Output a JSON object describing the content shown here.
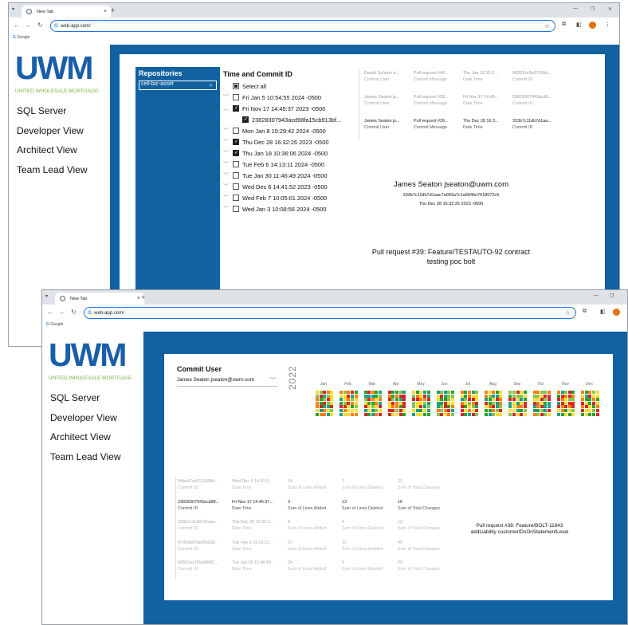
{
  "browser": {
    "tab_title": "New Tab",
    "address": "web-app.com/",
    "bookmark": "Google"
  },
  "sidebar": {
    "logo": "UWM",
    "tagline": "UNITED WHOLESALE MORTGAGE",
    "items": [
      {
        "label": "SQL Server"
      },
      {
        "label": "Developer View"
      },
      {
        "label": "Architect View"
      },
      {
        "label": "Team Lead View"
      }
    ]
  },
  "architect": {
    "repo_label": "Repositories",
    "repo_value": "cell-biz-asset",
    "slicer_title": "Time and Commit ID",
    "select_all": "Select all",
    "rows": [
      {
        "label": "Fri Jan 5 10:54:55 2024 -0500",
        "chev": "﹀",
        "state": "off",
        "indent": 0
      },
      {
        "label": "Fri Nov 17 14:45:37 2023 -0500",
        "chev": "︿",
        "state": "on",
        "indent": 0
      },
      {
        "label": "23828307943acd98fa15cb913bf...",
        "chev": "",
        "state": "on",
        "indent": 1
      },
      {
        "label": "Mon Jan 8 10:29:42 2024 -0500",
        "chev": "﹀",
        "state": "off",
        "indent": 0
      },
      {
        "label": "Thu Dec 28 16:32:26 2023 -0500",
        "chev": "﹀",
        "state": "on",
        "indent": 0
      },
      {
        "label": "Thu Jan 18 10:36:06 2024 -0500",
        "chev": "﹀",
        "state": "on",
        "indent": 0
      },
      {
        "label": "Tue Feb 6 14:13:11 2024 -0500",
        "chev": "﹀",
        "state": "off",
        "indent": 0
      },
      {
        "label": "Tue Jan 30 11:46:49 2024 -0500",
        "chev": "﹀",
        "state": "off",
        "indent": 0
      },
      {
        "label": "Wed Dec 6 14:41:52 2023 -0500",
        "chev": "﹀",
        "state": "off",
        "indent": 0
      },
      {
        "label": "Wed Feb 7 10:05:01 2024 -0500",
        "chev": "﹀",
        "state": "off",
        "indent": 0
      },
      {
        "label": "Wed Jan 3 10:08:56 2024 -0500",
        "chev": "﹀",
        "state": "off",
        "indent": 0
      }
    ],
    "cards": [
      {
        "dark": false,
        "user": "Daniel Schuler d...",
        "user_k": "Commit User",
        "msg": "Pull request #40...",
        "msg_k": "Commit Message",
        "date": "Thu Jan 18 10:3...",
        "date_k": "Date Time",
        "id": "462611e3e9719dc...",
        "id_k": "Commit ID"
      },
      {
        "dark": false,
        "user": "James Seaton js...",
        "user_k": "Commit User",
        "msg": "Pull request #38...",
        "msg_k": "Commit Message",
        "date": "Fri Nov 17 14:45...",
        "date_k": "Date Time",
        "id": "23828307943acd9...",
        "id_k": "Commit ID"
      },
      {
        "dark": true,
        "user": "James Seaton js...",
        "user_k": "Commit User",
        "msg": "Pull request #39...",
        "msg_k": "Commit Message",
        "date": "Thu Dec 28 16:3...",
        "date_k": "Date Time",
        "id": "333b7c11db7d1aa...",
        "id_k": "Commit ID"
      }
    ],
    "detail_name": "James Seaton jseaton@uwm.com",
    "detail_hash": "333b7c11db7d1aac7a093a7c1a6046e7618072c5",
    "detail_date": "Thu Dec 28 16:32:26 2023 -0500",
    "pr_line1": "Pull request #39: Feature/TESTAUTO-92 contract",
    "pr_line2": "testing poc bolt"
  },
  "developer": {
    "commit_user_label": "Commit User",
    "commit_user_value": "James Seaton jseaton@uwm.com",
    "year": "2022",
    "months": [
      "Jan",
      "Feb",
      "Mar",
      "Apr",
      "May",
      "Jun",
      "Jul",
      "Aug",
      "Sep",
      "Oct",
      "Nov",
      "Dec"
    ],
    "heat_colors": [
      "#d62728",
      "#ff7f0e",
      "#ffdd33",
      "#8bc34a",
      "#2ca02c",
      "#1f9e89"
    ],
    "rows": [
      {
        "dark": false,
        "id": "04bc47ce5113598c...",
        "id_k": "Commit ID",
        "date": "Wed Dec 6 14:41:5...",
        "date_k": "Date Time",
        "added": "14",
        "added_k": "Sum of Lines Added",
        "deleted": "7",
        "deleted_k": "Sum of Lines Deleted",
        "total": "21",
        "total_k": "Sum of Total Changes"
      },
      {
        "dark": true,
        "id": "23828307943acd98...",
        "id_k": "Commit ID",
        "date": "Fri Nov 17 14:45:37...",
        "date_k": "Date Time",
        "added": "3",
        "added_k": "Sum of Lines Added",
        "deleted": "13",
        "deleted_k": "Sum of Lines Deleted",
        "total": "16",
        "total_k": "Sum of Total Changes"
      },
      {
        "dark": false,
        "id": "333b7c11db7d1aac...",
        "id_k": "Commit ID",
        "date": "Thu Dec 28 16:32:2...",
        "date_k": "Date Time",
        "added": "8",
        "added_k": "Sum of Lines Added",
        "deleted": "4",
        "deleted_k": "Sum of Lines Deleted",
        "total": "12",
        "total_k": "Sum of Total Changes"
      },
      {
        "dark": false,
        "id": "47953b07def552a8...",
        "id_k": "Commit ID",
        "date": "Tue Feb 6 14:13:11...",
        "date_k": "Date Time",
        "added": "37",
        "added_k": "Sum of Lines Added",
        "deleted": "12",
        "deleted_k": "Sum of Lines Deleted",
        "total": "49",
        "total_k": "Sum of Total Changes"
      },
      {
        "dark": false,
        "id": "b0602ac1f0a89fdf1...",
        "id_k": "Commit ID",
        "date": "Tue Jan 30 11:46:49...",
        "date_k": "Date Time",
        "added": "24",
        "added_k": "Sum of Lines Added",
        "deleted": "5",
        "deleted_k": "Sum of Lines Deleted",
        "total": "29",
        "total_k": "Sum of Total Changes"
      }
    ],
    "pr_line1": "Pull request #38: Feature/BOLT-11843",
    "pr_line2": "addLiability customerIDsOnStatementLevel"
  }
}
